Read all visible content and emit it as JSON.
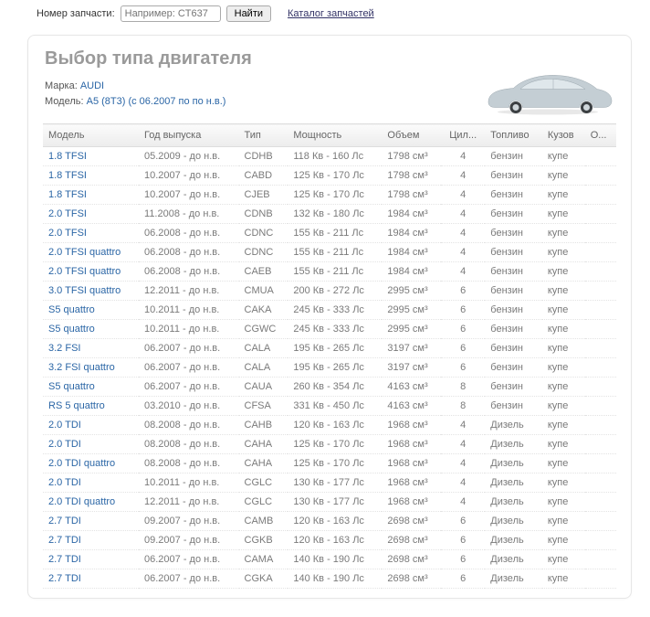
{
  "topbar": {
    "label": "Номер запчасти:",
    "placeholder": "Например: CT637",
    "find_label": "Найти",
    "catalog_label": "Каталог запчастей"
  },
  "panel": {
    "title": "Выбор типа двигателя",
    "brand_label": "Марка:",
    "brand": "AUDI",
    "model_label": "Модель:",
    "model": "A5 (8T3) (с 06.2007 по по н.в.)"
  },
  "table": {
    "headers": {
      "model": "Модель",
      "year": "Год выпуска",
      "type": "Тип",
      "power": "Мощность",
      "volume": "Объем",
      "cyl": "Цил...",
      "fuel": "Топливо",
      "body": "Кузов",
      "aux": "О..."
    },
    "rows": [
      {
        "model": "1.8 TFSI",
        "year": "05.2009 - до н.в.",
        "type": "CDHB",
        "power": "118 Кв - 160 Лс",
        "volume": "1798 см³",
        "cyl": "4",
        "fuel": "бензин",
        "body": "купе"
      },
      {
        "model": "1.8 TFSI",
        "year": "10.2007 - до н.в.",
        "type": "CABD",
        "power": "125 Кв - 170 Лс",
        "volume": "1798 см³",
        "cyl": "4",
        "fuel": "бензин",
        "body": "купе"
      },
      {
        "model": "1.8 TFSI",
        "year": "10.2007 - до н.в.",
        "type": "CJEB",
        "power": "125 Кв - 170 Лс",
        "volume": "1798 см³",
        "cyl": "4",
        "fuel": "бензин",
        "body": "купе"
      },
      {
        "model": "2.0 TFSI",
        "year": "11.2008 - до н.в.",
        "type": "CDNB",
        "power": "132 Кв - 180 Лс",
        "volume": "1984 см³",
        "cyl": "4",
        "fuel": "бензин",
        "body": "купе"
      },
      {
        "model": "2.0 TFSI",
        "year": "06.2008 - до н.в.",
        "type": "CDNC",
        "power": "155 Кв - 211 Лс",
        "volume": "1984 см³",
        "cyl": "4",
        "fuel": "бензин",
        "body": "купе"
      },
      {
        "model": "2.0 TFSI quattro",
        "year": "06.2008 - до н.в.",
        "type": "CDNC",
        "power": "155 Кв - 211 Лс",
        "volume": "1984 см³",
        "cyl": "4",
        "fuel": "бензин",
        "body": "купе"
      },
      {
        "model": "2.0 TFSI quattro",
        "year": "06.2008 - до н.в.",
        "type": "CAEB",
        "power": "155 Кв - 211 Лс",
        "volume": "1984 см³",
        "cyl": "4",
        "fuel": "бензин",
        "body": "купе"
      },
      {
        "model": "3.0 TFSI quattro",
        "year": "12.2011 - до н.в.",
        "type": "CMUA",
        "power": "200 Кв - 272 Лс",
        "volume": "2995 см³",
        "cyl": "6",
        "fuel": "бензин",
        "body": "купе"
      },
      {
        "model": "S5 quattro",
        "year": "10.2011 - до н.в.",
        "type": "CAKA",
        "power": "245 Кв - 333 Лс",
        "volume": "2995 см³",
        "cyl": "6",
        "fuel": "бензин",
        "body": "купе"
      },
      {
        "model": "S5 quattro",
        "year": "10.2011 - до н.в.",
        "type": "CGWC",
        "power": "245 Кв - 333 Лс",
        "volume": "2995 см³",
        "cyl": "6",
        "fuel": "бензин",
        "body": "купе"
      },
      {
        "model": "3.2 FSI",
        "year": "06.2007 - до н.в.",
        "type": "CALA",
        "power": "195 Кв - 265 Лс",
        "volume": "3197 см³",
        "cyl": "6",
        "fuel": "бензин",
        "body": "купе"
      },
      {
        "model": "3.2 FSI quattro",
        "year": "06.2007 - до н.в.",
        "type": "CALA",
        "power": "195 Кв - 265 Лс",
        "volume": "3197 см³",
        "cyl": "6",
        "fuel": "бензин",
        "body": "купе"
      },
      {
        "model": "S5 quattro",
        "year": "06.2007 - до н.в.",
        "type": "CAUA",
        "power": "260 Кв - 354 Лс",
        "volume": "4163 см³",
        "cyl": "8",
        "fuel": "бензин",
        "body": "купе"
      },
      {
        "model": "RS 5 quattro",
        "year": "03.2010 - до н.в.",
        "type": "CFSA",
        "power": "331 Кв - 450 Лс",
        "volume": "4163 см³",
        "cyl": "8",
        "fuel": "бензин",
        "body": "купе"
      },
      {
        "model": "2.0 TDI",
        "year": "08.2008 - до н.в.",
        "type": "CAHB",
        "power": "120 Кв - 163 Лс",
        "volume": "1968 см³",
        "cyl": "4",
        "fuel": "Дизель",
        "body": "купе"
      },
      {
        "model": "2.0 TDI",
        "year": "08.2008 - до н.в.",
        "type": "CAHA",
        "power": "125 Кв - 170 Лс",
        "volume": "1968 см³",
        "cyl": "4",
        "fuel": "Дизель",
        "body": "купе"
      },
      {
        "model": "2.0 TDI quattro",
        "year": "08.2008 - до н.в.",
        "type": "CAHA",
        "power": "125 Кв - 170 Лс",
        "volume": "1968 см³",
        "cyl": "4",
        "fuel": "Дизель",
        "body": "купе"
      },
      {
        "model": "2.0 TDI",
        "year": "10.2011 - до н.в.",
        "type": "CGLC",
        "power": "130 Кв - 177 Лс",
        "volume": "1968 см³",
        "cyl": "4",
        "fuel": "Дизель",
        "body": "купе"
      },
      {
        "model": "2.0 TDI quattro",
        "year": "12.2011 - до н.в.",
        "type": "CGLC",
        "power": "130 Кв - 177 Лс",
        "volume": "1968 см³",
        "cyl": "4",
        "fuel": "Дизель",
        "body": "купе"
      },
      {
        "model": "2.7 TDI",
        "year": "09.2007 - до н.в.",
        "type": "CAMB",
        "power": "120 Кв - 163 Лс",
        "volume": "2698 см³",
        "cyl": "6",
        "fuel": "Дизель",
        "body": "купе"
      },
      {
        "model": "2.7 TDI",
        "year": "09.2007 - до н.в.",
        "type": "CGKB",
        "power": "120 Кв - 163 Лс",
        "volume": "2698 см³",
        "cyl": "6",
        "fuel": "Дизель",
        "body": "купе"
      },
      {
        "model": "2.7 TDI",
        "year": "06.2007 - до н.в.",
        "type": "CAMA",
        "power": "140 Кв - 190 Лс",
        "volume": "2698 см³",
        "cyl": "6",
        "fuel": "Дизель",
        "body": "купе"
      },
      {
        "model": "2.7 TDI",
        "year": "06.2007 - до н.в.",
        "type": "CGKA",
        "power": "140 Кв - 190 Лс",
        "volume": "2698 см³",
        "cyl": "6",
        "fuel": "Дизель",
        "body": "купе"
      }
    ]
  }
}
